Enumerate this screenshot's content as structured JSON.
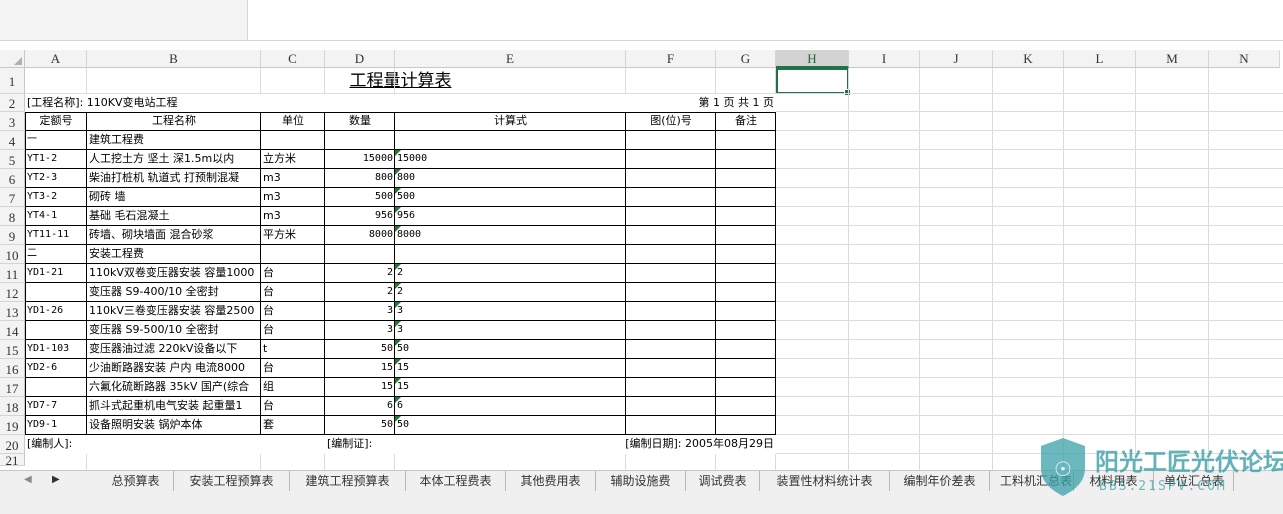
{
  "columns": [
    "A",
    "B",
    "C",
    "D",
    "E",
    "F",
    "G",
    "H",
    "I",
    "J",
    "K",
    "L",
    "M",
    "N"
  ],
  "selected_column": "H",
  "row_numbers": [
    "1",
    "2",
    "3",
    "4",
    "5",
    "6",
    "7",
    "8",
    "9",
    "10",
    "11",
    "12",
    "13",
    "14",
    "15",
    "16",
    "17",
    "18",
    "19",
    "20",
    "21"
  ],
  "sheet": {
    "title": "工程量计算表",
    "project_label": "[工程名称]: 110KV变电站工程",
    "page_label": "第 1 页 共 1 页",
    "headers": [
      "定额号",
      "工程名称",
      "单位",
      "数量",
      "计算式",
      "图(位)号",
      "备注"
    ],
    "rows": [
      {
        "code": "一",
        "name": "建筑工程费",
        "unit": "",
        "qty": "",
        "formula": ""
      },
      {
        "code": "YT1-2",
        "name": "人工挖土方  坚土 深1.5m以内",
        "unit": "立方米",
        "qty": "15000",
        "formula": "15000"
      },
      {
        "code": "YT2-3",
        "name": "柴油打桩机 轨道式 打预制混凝",
        "unit": "m3",
        "qty": "800",
        "formula": "800"
      },
      {
        "code": "YT3-2",
        "name": "砌砖 墙",
        "unit": "m3",
        "qty": "500",
        "formula": "500"
      },
      {
        "code": "YT4-1",
        "name": "基础 毛石混凝土",
        "unit": "m3",
        "qty": "956",
        "formula": "956"
      },
      {
        "code": "YT11-11",
        "name": "砖墙、砌块墙面 混合砂浆",
        "unit": "平方米",
        "qty": "8000",
        "formula": "8000"
      },
      {
        "code": "二",
        "name": "安装工程费",
        "unit": "",
        "qty": "",
        "formula": ""
      },
      {
        "code": "YD1-21",
        "name": "110kV双卷变压器安装  容量1000",
        "unit": "台",
        "qty": "2",
        "formula": "2"
      },
      {
        "code": "",
        "name": "变压器 S9-400/10 全密封",
        "unit": "台",
        "qty": "2",
        "formula": "2"
      },
      {
        "code": "YD1-26",
        "name": "110kV三卷变压器安装  容量2500",
        "unit": "台",
        "qty": "3",
        "formula": "3"
      },
      {
        "code": "",
        "name": "变压器 S9-500/10 全密封",
        "unit": "台",
        "qty": "3",
        "formula": "3"
      },
      {
        "code": "YD1-103",
        "name": "变压器油过滤  220kV设备以下",
        "unit": "t",
        "qty": "50",
        "formula": "50"
      },
      {
        "code": "YD2-6",
        "name": "少油断路器安装  户内 电流8000",
        "unit": "台",
        "qty": "15",
        "formula": "15"
      },
      {
        "code": "",
        "name": "六氟化硫断路器 35kV 国产(综合",
        "unit": "组",
        "qty": "15",
        "formula": "15"
      },
      {
        "code": "YD7-7",
        "name": "抓斗式起重机电气安装  起重量1",
        "unit": "台",
        "qty": "6",
        "formula": "6"
      },
      {
        "code": "YD9-1",
        "name": "设备照明安装  锅炉本体",
        "unit": "套",
        "qty": "50",
        "formula": "50"
      }
    ],
    "footer_preparer": "[编制人]:",
    "footer_cert": "[编制证]:",
    "footer_date": "[编制日期]: 2005年08月29日"
  },
  "tabs": [
    "总预算表",
    "安装工程预算表",
    "建筑工程预算表",
    "本体工程费表",
    "其他费用表",
    "辅助设施费",
    "调试费表",
    "装置性材料统计表",
    "编制年价差表",
    "工料机汇总表",
    "材料用表",
    "单位汇总表"
  ],
  "watermark": {
    "text": "阳光工匠光伏论坛",
    "url": "BBS.21SPV.COM"
  },
  "colors": {
    "accent": "#217346",
    "watermark": "#3aa0a8"
  }
}
